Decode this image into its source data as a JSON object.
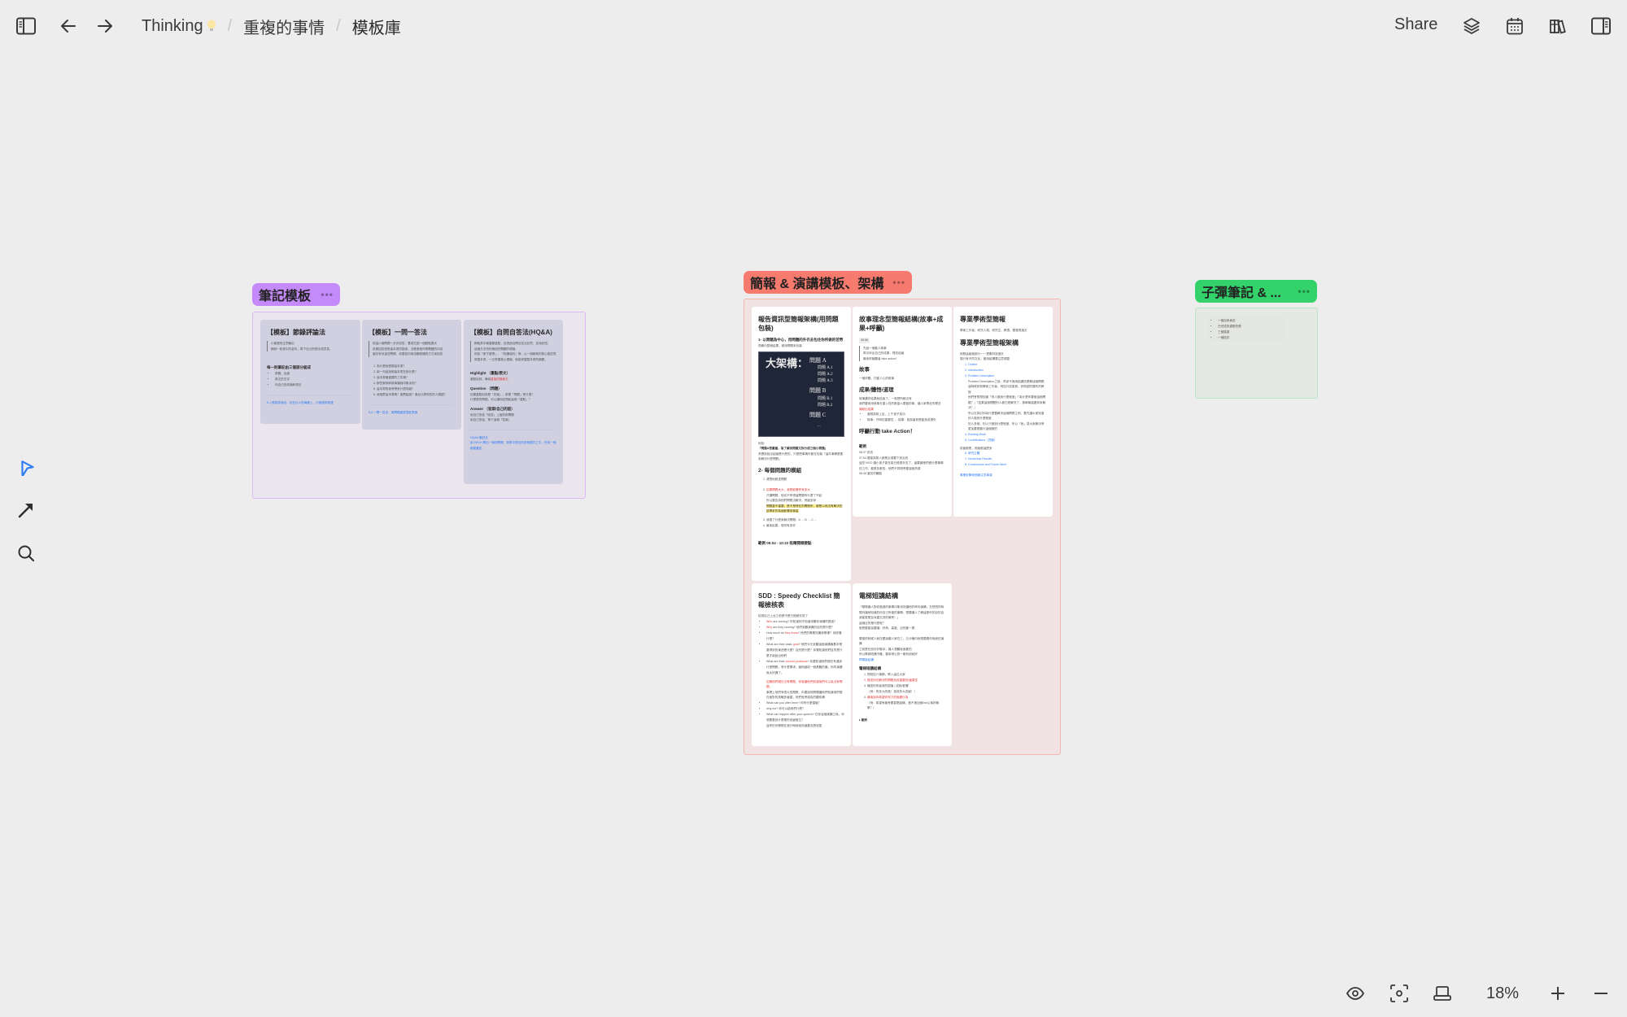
{
  "topbar": {
    "breadcrumb": [
      {
        "label": "Thinking",
        "emoji_icon": "lightbulb-icon"
      },
      {
        "label": "重複的事情"
      },
      {
        "label": "模板庫"
      }
    ],
    "share_label": "Share",
    "icons": [
      "sidebar-toggle-icon",
      "back-arrow-icon",
      "forward-arrow-icon",
      "layers-icon",
      "calendar-icon",
      "library-icon",
      "right-panel-icon"
    ]
  },
  "left_tools": [
    "select-pointer-icon",
    "connector-arrow-icon",
    "search-icon"
  ],
  "bottombar": {
    "zoom_level": "18%",
    "icons": [
      "eye-icon",
      "focus-icon",
      "presentation-icon",
      "zoom-in-icon",
      "zoom-out-icon"
    ]
  },
  "colors": {
    "frame1_accent": "#c58af9",
    "frame2_accent": "#f77a6f",
    "frame3_accent": "#33d26b",
    "link": "#2f7cf6",
    "selected_tool": "#2f7cf6"
  },
  "frames": {
    "notes": {
      "label": "筆記模板",
      "cards": [
        {
          "title": "【模板】節錄評論法",
          "quote": [
            "小紫燈的注意輸出",
            "摘錄一段書中的金句，寫下自己的想法或意見。"
          ],
          "section": "每一則筆記由三個部分組成",
          "bullets": [
            "書籍、出處",
            "原文的文字",
            "你自己的評論和想法"
          ],
          "footer_link": "5-1 節錄評論法：站在巨人的肩膀上，引發優秀更遠"
        },
        {
          "title": "【模板】一問一答法",
          "quote": [
            "用這六個問題一步步回答，養成在讀一個觀點要天",
            "試著回答他對這本書的疑惑，沒看過他所寫關鍵的內容",
            "當初有何這些問題，你要如何用淺顯易懂的方式來回答"
          ],
          "list": [
            "為什麼我想讀這本書？",
            "用一句話說明這本書在說什麼？",
            "這本書最重要的三件事？",
            "那些案例和故事讓我印象深刻？",
            "這本書對我會帶來什麼改變？",
            "我推薦這本書嗎？推薦給誰？適合什麼特質的人閱讀？"
          ],
          "footer_link": "5-3 一問一答法：用問題重塑混亂思緒"
        },
        {
          "title": "【模板】自問自答法(HQ&A)",
          "quote": [
            "摘取書中最重要重點，自透過自問自答法反思，加深記憶。",
            "這個方法特別適用於關鍵的理論。",
            "例如「原子習慣」、「知識複利」等，以一個嶄新的核心觀念貫穿整本書，一旦掌握核心理論，就能掌握整本書的綱要。"
          ],
          "sections": [
            {
              "heading": "Highlight （重點/原文）",
              "lines": [
                {
                  "text": "重點紀錄，單純",
                  "red": "直接的摘原文"
                }
              ]
            },
            {
              "heading": "Question （問題）",
              "lines": [
                {
                  "text": "如果重點紀錄是「答案」，那麼「問題」是什麼？"
                },
                {
                  "text": "什麼樣的問題，可以讓你回想起這個「重點」？"
                }
              ]
            },
            {
              "heading": "Answer （答案/自己的話）",
              "lines": [
                {
                  "text": "用自己的話「回答」上面的那問題"
                },
                {
                  "text": "用自己的話，寫下這個「答案」"
                }
              ]
            }
          ],
          "footer_links": [
            "HQ&A 筆記法",
            "用 5W1H 問出一個好問題，與書中提出的其他模式之中，任何一個都能筆記"
          ]
        }
      ]
    },
    "presentation": {
      "label": "簡報 & 演講模板、架構",
      "cards": [
        {
          "title": "報告資訊型簡報架構(用問題包裝)",
          "h4_1": "1- 以問題為中心，用問題的外衣去包住你所做的苦勞",
          "intro": "簡報內整個結果，都用問題來包裝",
          "image": {
            "big": "大架構：",
            "q1": "問題 A",
            "q1_subs": [
              "問題 A.1",
              "問題 A.2",
              "問題 A.3"
            ],
            "q2": "問題 B",
            "q2_subs": [
              "問題 B.1",
              "問題 B.2"
            ],
            "q3": "問題 C",
            "more": "..."
          },
          "after_image": [
            "例如：",
            "「問題A很嚴重，為了解決問題又拆分成三個小問題」",
            "其實該說出結論是什麼的，只是把事情外套在包裝「這件事情是要來解決什麼問題」"
          ],
          "h4_2": "2- 每個問題的模組",
          "steps": [
            {
              "text": "清楚地敘述問題"
            },
            {
              "text": "如果問題太大，我是影響會有多大",
              "red": true,
              "sub": [
                "只講問題，他也不會得這問題有什麼了不起",
                "所以要告訴他們問題沒解決，會變多慘"
              ],
              "highlight": "問題重不重要，是不是得在的問題所，都是以他沒有解決的話帶來的負面影響來衡量"
            },
            {
              "text": "我做了什麼來解決問題：A → B → C ..."
            },
            {
              "text": "最後結果，現況有多好"
            }
          ],
          "footer": "範例 05:04 - 10:22 吸睛開頭要點"
        },
        {
          "title": "故事理念型簡報結構(故事+成果+呼籲)",
          "tag": "06:58",
          "quote": [
            "先說一個動人故事",
            "再引申出自己的成果，理念結論",
            "最後呼籲聽者 take action！"
          ],
          "s1_title": "故事",
          "s1_text": "一個好聽，打動人心的故事",
          "s2_title": "成果/體悟/道理",
          "s2_lines": [
            "故事講完結果就結束了，一般把所都沒有",
            "我們要用用故事去重入性的數量人要做的事，讓人家帶走的理念"
          ],
          "s2_red": "傳遞出成果",
          "s2_bullets": [
            "曾經幫助上百，上千孩子成功",
            "故事：守時的重要性 → 成果：因為當到是能造成損失"
          ],
          "s3_title": "呼籲行動 take Action！",
          "example_title": "範例",
          "example_lines": [
            "06:27 前言",
            "07:54 要能幫助人都是必須要下到治的",
            "這些 NGO 讓小孩子能在能已經很辛苦了，還要讓他們做什麼事情的工作，都是多數的，他們不同得會要這個資源",
            "08:38 當初的體驗"
          ]
        },
        {
          "title": "專業學術型簡報",
          "subtitle": "學術工作者、研究人員、研究生、教授、要發表論文",
          "title2": "專業學術型簡報架構",
          "intro": [
            "按照這幾個部分一一把素材放進去",
            "隨行有不同文化，套用結構要注意調整"
          ],
          "outline": [
            "Outline",
            "Introduction",
            "Problem Description"
          ],
          "problem_notes": [
            "Problem Description之後，再來不適用給講怎麼解這個問題",
            "這時候其他學術工作者，例如口試委員，其他讀的擺布的教授",
            "他們會想想知道「別人做到什麼程度」「為什麼你要做這個問題？」「如果這個問題別人都已經解決了，那幹嘛還要你來解決？」",
            "所以在探討你為什麼要解決這個問題之前，要先讓大家知道別人做到什麼程度",
            "別人多做，別人只做到什麼程度，所以「我」幫大家解決會更加要更動行這個做的"
          ],
          "outline2": [
            "Existing Work",
            "Contributions（貢獻）"
          ],
          "mid_line": "前面都是，前面都這麼多",
          "outline3": [
            "研究主體",
            "Numerical Results",
            "Conclusions and Future Work"
          ],
          "footer_link": "專業型學術簡報注意事項"
        },
        {
          "title": "SDD : Speedy Checklist 簡報檢核表",
          "intro": "檢測自己上台之前是不是已經都完成了",
          "items": [
            {
              "red": "Who",
              "text": " are coming? 你知道知不知道來聽你演講的是誰？"
            },
            {
              "red": "Why",
              "text": " are they coming? 他們來聽演講的目的是什麼？"
            },
            {
              "pre": "How much do ",
              "red": "they know",
              "text": "? 他們的專業知識到哪裡？到底懂什麼？"
            },
            {
              "pre": "What are their basic ",
              "red": "goal",
              "text": "? 他們今天來聽這個演講最基本想要得到的東西是什麼？目的是什麼？你要知道他們目的是什麼才能說出他們"
            },
            {
              "pre": "What are their ",
              "red": "current problems",
              "text": "? 你要知道他們現在有遇到什麼問題，有什麼需求，當他變成一個具體的痛，你的演講就太好講了。",
              "red2": "如果他們現在沒有問題，你就讓他們知道他們可以為沒有問題。",
              "extra": "事實上他們有很大的問題，你要說他問題讓他們知道他們現在面對的挑戰多嚴重，他們就會認真的聽你講"
            },
            {
              "text": "What can you offer them? 你有什麼價值？"
            },
            {
              "text": "why me? 你可以給他們什麼？"
            },
            {
              "text": "What can happen after your speech? 在你這個演講之後，你想要看到什麼樣的改變發生？",
              "extra": "這會在你實際在進行時就就知道要怎麼收尾"
            }
          ]
        },
        {
          "title": "電梯短講結構",
          "quote_lines": [
            "「剛剛讓人對你做過的事情印象深刻讓他好奇你演講，在短短的時間內讓他知道的你自己所做的事情，想要讓人了解這是你的目的自我能更更加深重交流的機會！」",
            "這個目的是什麼呢？",
            "就是要能說要讓：好奇、高度、目的都一樣"
          ],
          "mid_lines": [
            "電梯的時候人就在跟說讓人家在三、五分鐘內就想要跟你後面的演講",
            "之前是在設計好範本，讓人想聽後面要的",
            "所以電梯短講不難，要用得公的一套有用就好"
          ],
          "mid_link": "閃電版結構",
          "section_title": "電梯短講結構",
          "steps": [
            {
              "text": "簡短自介事蹟，帶入這位大家"
            },
            {
              "text": "敘述你在解決的問題及其重要性/嚴重性",
              "red": true
            },
            {
              "text": "陳述你所創造的價值 / 成就/影響",
              "sub": "（例：有多大改進！造成多大改變！）"
            },
            {
              "text": "最後說你希望你努力的後續行為",
              "red": true,
              "sub": "（例：希望有機會跟甚麼組織，進不進加個line以後好聯繫？）"
            }
          ],
          "footer_bullet": "範例"
        }
      ]
    },
    "bullet_notes": {
      "label": "子彈筆記 & ...",
      "bullets": [
        "一個自我肯定",
        "已完成的重點任務",
        "三個感激",
        "一個檢討"
      ]
    }
  }
}
